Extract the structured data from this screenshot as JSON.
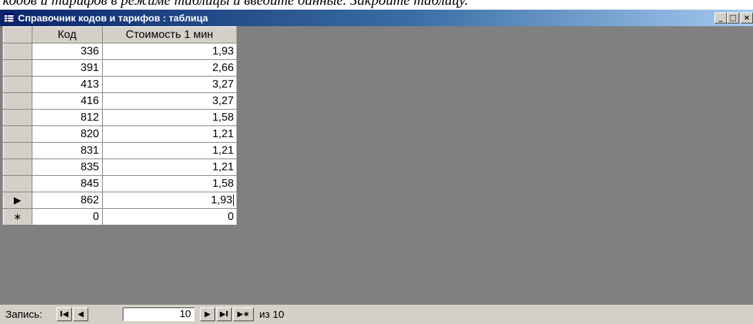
{
  "document": {
    "partial_text": "кодов и тарифов в режиме таблицы и введите данные. Закройте таблицу."
  },
  "window": {
    "title": "Справочник кодов и тарифов : таблица",
    "minimize_glyph": "_",
    "maximize_glyph": "□",
    "close_glyph": "×"
  },
  "table": {
    "columns": [
      "Код",
      "Стоимость 1 мин"
    ],
    "rows": [
      {
        "code": "336",
        "cost": "1,93"
      },
      {
        "code": "391",
        "cost": "2,66"
      },
      {
        "code": "413",
        "cost": "3,27"
      },
      {
        "code": "416",
        "cost": "3,27"
      },
      {
        "code": "812",
        "cost": "1,58"
      },
      {
        "code": "820",
        "cost": "1,21"
      },
      {
        "code": "831",
        "cost": "1,21"
      },
      {
        "code": "835",
        "cost": "1,21"
      },
      {
        "code": "845",
        "cost": "1,58"
      },
      {
        "code": "862",
        "cost": "1,93"
      }
    ],
    "current_row_marker": "▶",
    "new_row": {
      "marker": "∗",
      "code": "0",
      "cost": "0"
    }
  },
  "navigation": {
    "label": "Запись:",
    "first_glyph": "I◀",
    "prev_glyph": "◀",
    "current_record": "10",
    "next_glyph": "▶",
    "last_glyph": "▶I",
    "new_glyph": "▶∗",
    "of_text": "из 10"
  }
}
